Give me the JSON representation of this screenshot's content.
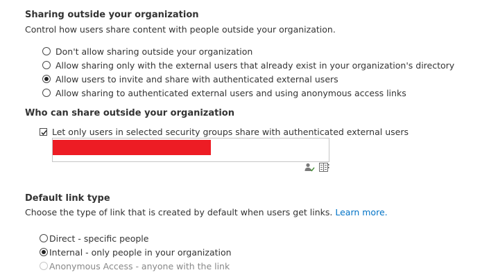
{
  "sharing_outside": {
    "title": "Sharing outside your organization",
    "description": "Control how users share content with people outside your organization.",
    "options": [
      {
        "label": "Don't allow sharing outside your organization",
        "selected": false
      },
      {
        "label": "Allow sharing only with the external users that already exist in your organization's directory",
        "selected": false
      },
      {
        "label": "Allow users to invite and share with authenticated external users",
        "selected": true
      },
      {
        "label": "Allow sharing to authenticated external users and using anonymous access links",
        "selected": false
      }
    ]
  },
  "who_can_share": {
    "title": "Who can share outside your organization",
    "checkbox_label": "Let only users in selected security groups share with authenticated external users",
    "checked": true,
    "icons": [
      "check-names-icon",
      "browse-directory-icon"
    ]
  },
  "default_link": {
    "title": "Default link type",
    "description": "Choose the type of link that is created by default when users get links.",
    "learn_more": "Learn more.",
    "options": [
      {
        "label": "Direct - specific people",
        "selected": false,
        "disabled": false
      },
      {
        "label": "Internal - only people in your organization",
        "selected": true,
        "disabled": false
      },
      {
        "label": "Anonymous Access - anyone with the link",
        "selected": false,
        "disabled": true
      }
    ]
  },
  "colors": {
    "link": "#0072c6",
    "redaction": "#ed1c24",
    "text": "#333333"
  }
}
